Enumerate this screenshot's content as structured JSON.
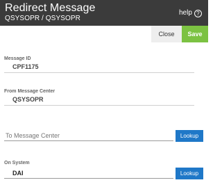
{
  "header": {
    "title": "Redirect Message",
    "subtitle": "QSYSOPR / QSYSOPR",
    "help_label": "help",
    "help_icon": "question-circle-icon"
  },
  "toolbar": {
    "close_label": "Close",
    "save_label": "Save"
  },
  "form": {
    "message_id": {
      "label": "Message ID",
      "value": "CPF1175"
    },
    "from_message_center": {
      "label": "From Message Center",
      "value": "QSYSOPR"
    },
    "to_message_center": {
      "placeholder": "To Message Center",
      "value": "",
      "lookup_label": "Lookup"
    },
    "on_system": {
      "label": "On System",
      "value": "DAI",
      "lookup_label": "Lookup"
    }
  },
  "colors": {
    "header_bg": "#3b3b3b",
    "save_bg": "#7cc242",
    "lookup_bg": "#1f78c8",
    "close_bg": "#eeeeee"
  }
}
